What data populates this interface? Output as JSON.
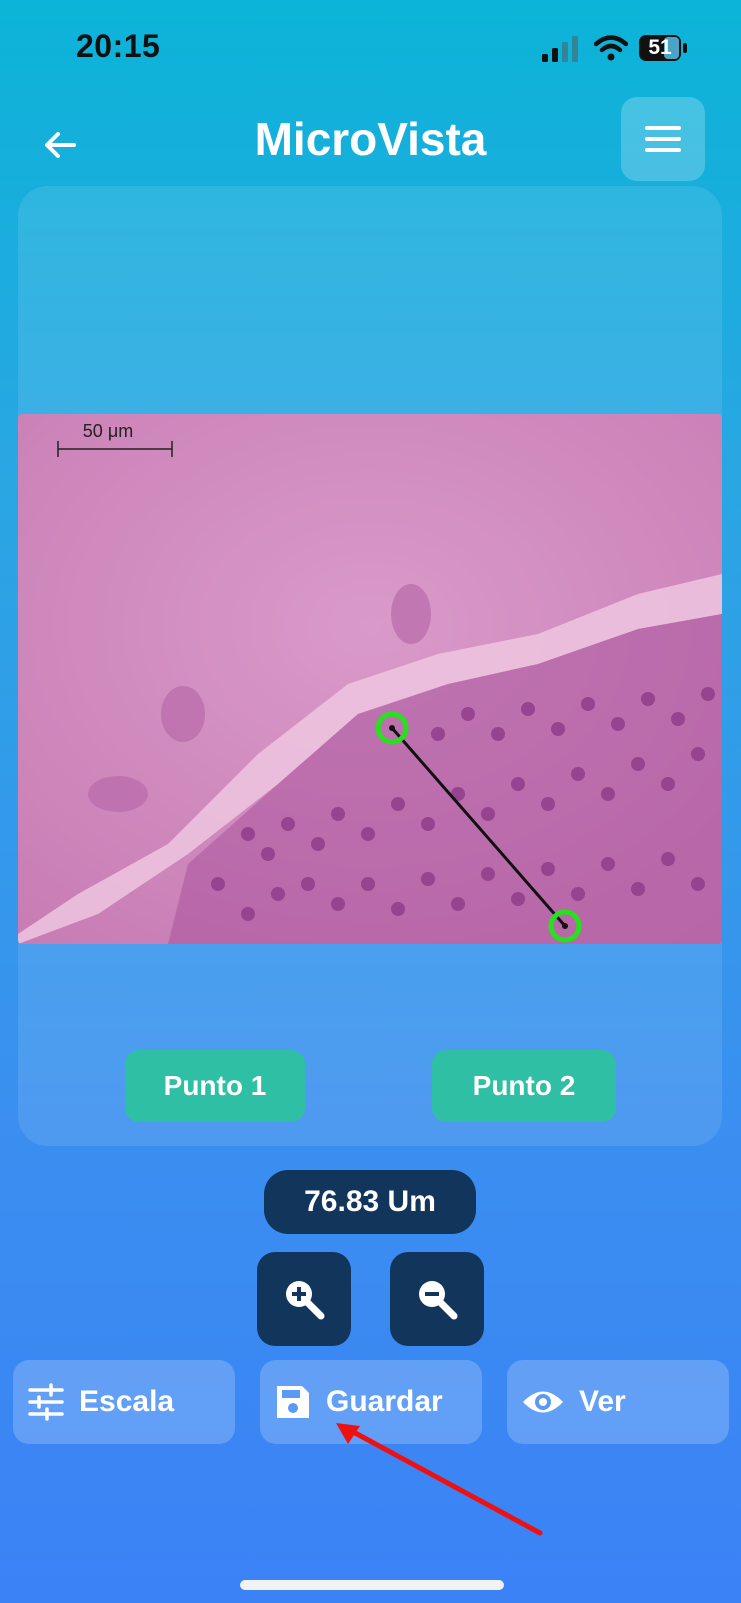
{
  "status_bar": {
    "time": "20:15",
    "battery": "51"
  },
  "header": {
    "title": "MicroVista"
  },
  "image": {
    "scale_label": "50 μm"
  },
  "buttons": {
    "point1": "Punto 1",
    "point2": "Punto 2"
  },
  "measurement": "76.83 Um",
  "actions": {
    "scale": "Escala",
    "save": "Guardar",
    "view": "Ver"
  },
  "icons": [
    "back-arrow-icon",
    "menu-icon",
    "zoom-in-icon",
    "zoom-out-icon",
    "tune-icon",
    "save-icon",
    "eye-icon"
  ],
  "colors": {
    "accent_green": "#2ebfa5",
    "dark_navy": "#12355b",
    "marker_green": "#27e01e"
  }
}
